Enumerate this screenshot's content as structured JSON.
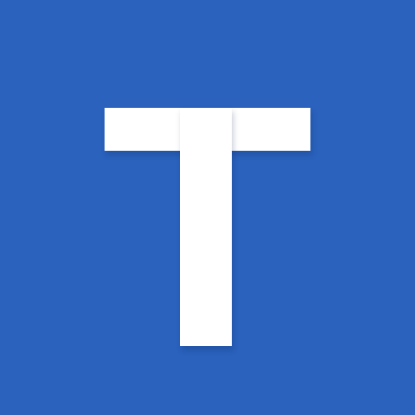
{
  "app_icon": {
    "letter": "T",
    "background_color": "#2a62bd",
    "glyph_color": "#ffffff"
  }
}
